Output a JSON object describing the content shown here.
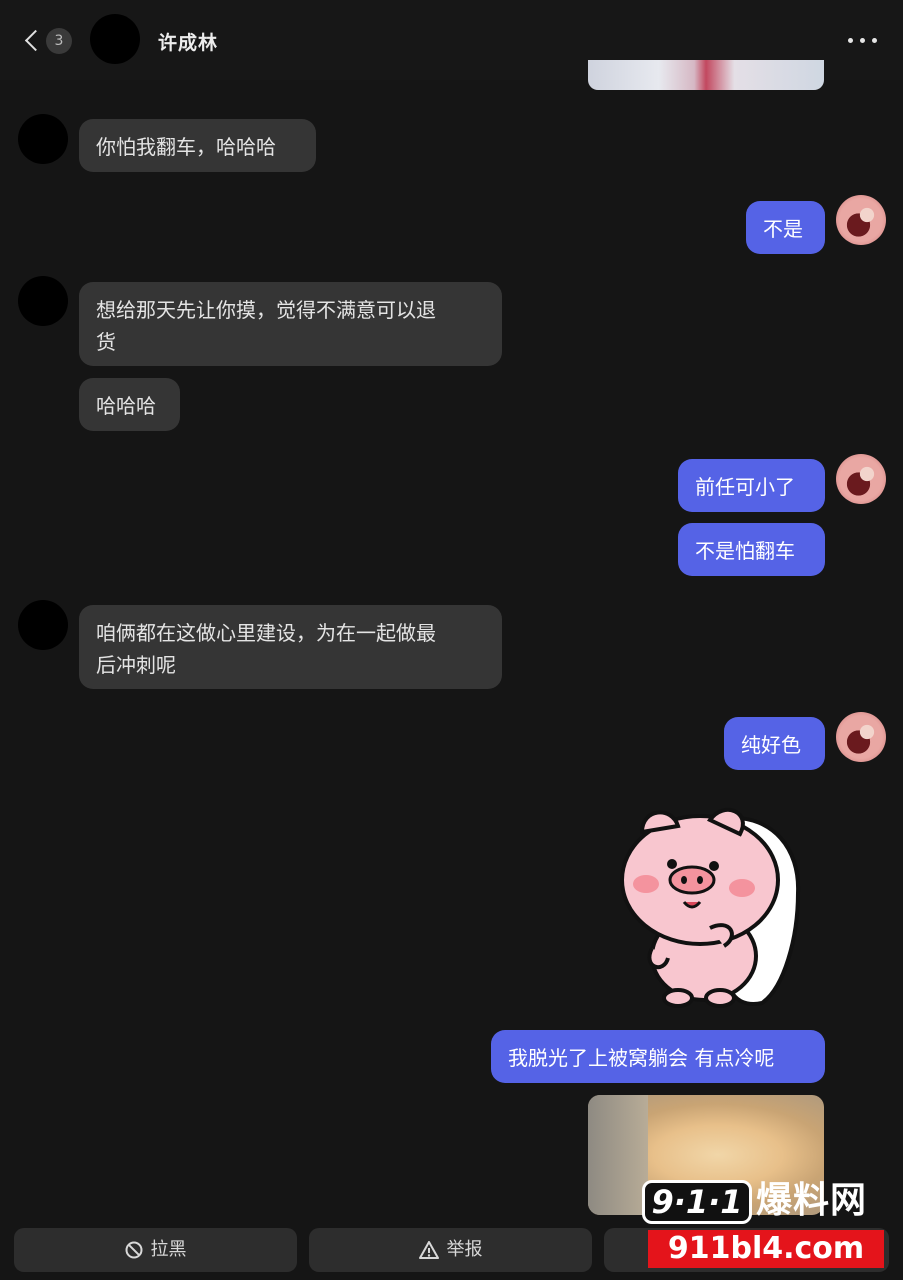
{
  "header": {
    "back_count": "3",
    "contact_name": "许成林"
  },
  "messages": [
    {
      "side": "in",
      "text": "你怕我翻车，哈哈哈"
    },
    {
      "side": "out",
      "text": "不是"
    },
    {
      "side": "in",
      "text": "想给那天先让你摸，觉得不满意可以退货"
    },
    {
      "side": "in",
      "text": "哈哈哈"
    },
    {
      "side": "out",
      "text": "前任可小了"
    },
    {
      "side": "out",
      "text": "不是怕翻车"
    },
    {
      "side": "in",
      "text": "咱俩都在这做心里建设，为在一起做最后冲刺呢"
    },
    {
      "side": "out",
      "text": "纯好色"
    },
    {
      "side": "out",
      "text": "我脱光了上被窝躺会 有点冷呢"
    }
  ],
  "message_lines": {
    "m3_line1": "想给那天先让你摸，觉得不满意可以退",
    "m3_line2": "货",
    "m7_line1": "咱俩都在这做心里建设，为在一起做最",
    "m7_line2": "后冲刺呢"
  },
  "actions": {
    "block": "拉黑",
    "report": "举报"
  },
  "watermark": {
    "badge": "9·1·1",
    "name": "爆料网",
    "url": "911bl4.com"
  }
}
